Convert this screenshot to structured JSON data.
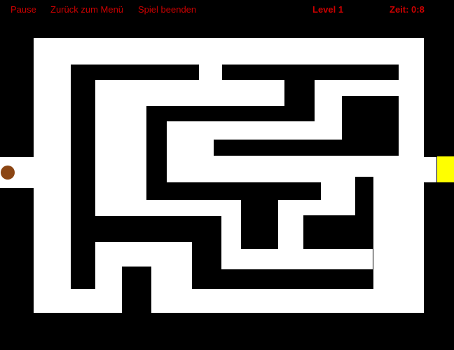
{
  "menu": {
    "pause_label": "Pause",
    "menu_label": "Zurück zum Menü",
    "quit_label": "Spiel beenden"
  },
  "hud": {
    "level_label": "Level 1",
    "time_label": "Zeit: 0:8"
  },
  "colors": {
    "background": "#000000",
    "path": "#ffffff",
    "wall": "#000000",
    "text": "#cc0000",
    "player": "#8b4513",
    "goal": "#ffff00"
  }
}
